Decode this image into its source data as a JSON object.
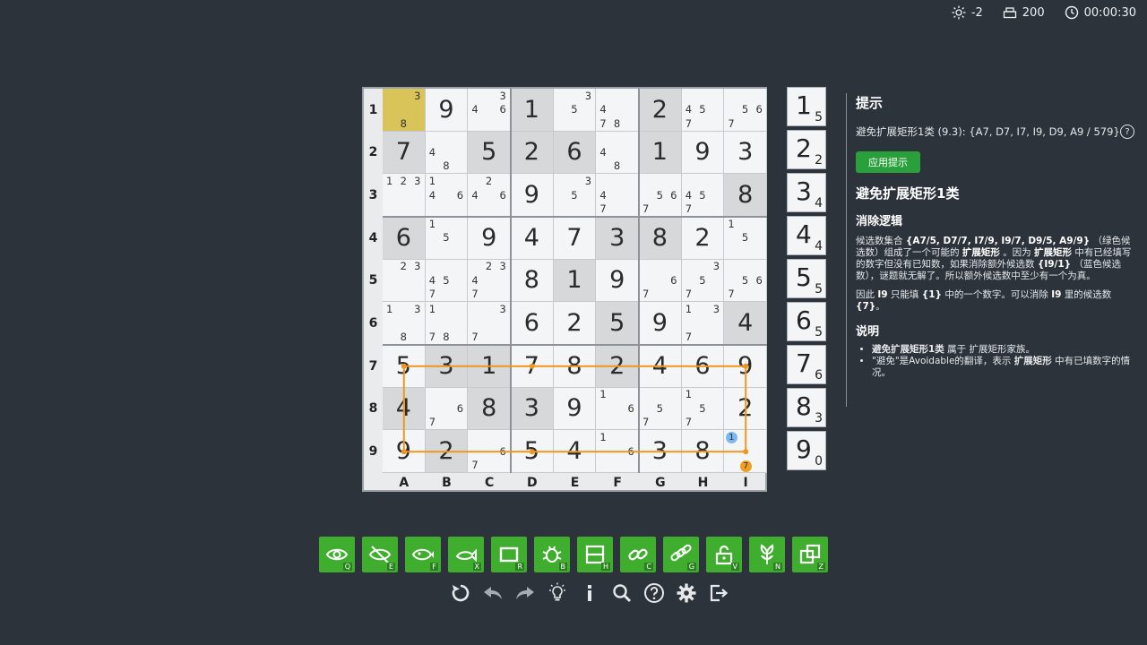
{
  "status": {
    "brightness": "-2",
    "score": "200",
    "timer": "00:00:30"
  },
  "rows": [
    "1",
    "2",
    "3",
    "4",
    "5",
    "6",
    "7",
    "8",
    "9"
  ],
  "cols": [
    "A",
    "B",
    "C",
    "D",
    "E",
    "F",
    "G",
    "H",
    "I"
  ],
  "cells": [
    [
      {
        "c": [
          "",
          "",
          "3",
          "",
          "",
          "",
          "",
          "8",
          ""
        ],
        "bg": "hl"
      },
      {
        "v": "9"
      },
      {
        "c": [
          "",
          "",
          "3",
          "4",
          "",
          "6",
          "",
          "",
          ""
        ]
      },
      {
        "v": "1",
        "bg": "g"
      },
      {
        "c": [
          "",
          "",
          "3",
          "",
          "5",
          "",
          "",
          "",
          ""
        ]
      },
      {
        "c": [
          "",
          "",
          "",
          "4",
          "",
          "",
          "7",
          "8",
          ""
        ]
      },
      {
        "v": "2",
        "bg": "g"
      },
      {
        "c": [
          "",
          "",
          "",
          "4",
          "5",
          "",
          "7",
          "",
          ""
        ]
      },
      {
        "c": [
          "",
          "",
          "",
          "",
          "5",
          "6",
          "7",
          "",
          ""
        ]
      }
    ],
    [
      {
        "v": "7",
        "bg": "g"
      },
      {
        "c": [
          "",
          "",
          "",
          "4",
          "",
          "",
          "",
          "8",
          ""
        ]
      },
      {
        "v": "5",
        "bg": "g"
      },
      {
        "v": "2",
        "bg": "g"
      },
      {
        "v": "6",
        "bg": "g"
      },
      {
        "c": [
          "",
          "",
          "",
          "4",
          "",
          "",
          "",
          "8",
          ""
        ]
      },
      {
        "v": "1",
        "bg": "g"
      },
      {
        "v": "9"
      },
      {
        "v": "3"
      }
    ],
    [
      {
        "c": [
          "1",
          "2",
          "3",
          "",
          "",
          "",
          "",
          "",
          ""
        ]
      },
      {
        "c": [
          "1",
          "",
          "",
          "4",
          "",
          "6",
          "",
          "",
          ""
        ]
      },
      {
        "c": [
          "",
          "2",
          "",
          "4",
          "",
          "6",
          "",
          "",
          ""
        ]
      },
      {
        "v": "9"
      },
      {
        "c": [
          "",
          "",
          "3",
          "",
          "5",
          "",
          "",
          "",
          ""
        ]
      },
      {
        "c": [
          "",
          "",
          "",
          "4",
          "",
          "",
          "7",
          "",
          ""
        ]
      },
      {
        "c": [
          "",
          "",
          "",
          "",
          "5",
          "6",
          "7",
          "",
          ""
        ]
      },
      {
        "c": [
          "",
          "",
          "",
          "4",
          "5",
          "",
          "7",
          "",
          ""
        ]
      },
      {
        "v": "8",
        "bg": "g"
      }
    ],
    [
      {
        "v": "6",
        "bg": "g"
      },
      {
        "c": [
          "1",
          "",
          "",
          "",
          "5",
          "",
          "",
          "",
          ""
        ]
      },
      {
        "v": "9"
      },
      {
        "v": "4"
      },
      {
        "v": "7"
      },
      {
        "v": "3",
        "bg": "g"
      },
      {
        "v": "8",
        "bg": "g"
      },
      {
        "v": "2"
      },
      {
        "c": [
          "1",
          "",
          "",
          "",
          "5",
          "",
          "",
          "",
          ""
        ]
      }
    ],
    [
      {
        "c": [
          "",
          "2",
          "3",
          "",
          "",
          "",
          "",
          "",
          ""
        ]
      },
      {
        "c": [
          "",
          "",
          "",
          "4",
          "5",
          "",
          "7",
          "",
          ""
        ]
      },
      {
        "c": [
          "",
          "2",
          "3",
          "4",
          "",
          "",
          "7",
          "",
          ""
        ]
      },
      {
        "v": "8"
      },
      {
        "v": "1",
        "bg": "g"
      },
      {
        "v": "9"
      },
      {
        "c": [
          "",
          "",
          "",
          "",
          "",
          "6",
          "7",
          "",
          ""
        ]
      },
      {
        "c": [
          "",
          "",
          "3",
          "",
          "5",
          "",
          "7",
          "",
          ""
        ]
      },
      {
        "c": [
          "",
          "",
          "",
          "",
          "5",
          "6",
          "7",
          "",
          ""
        ]
      }
    ],
    [
      {
        "c": [
          "1",
          "",
          "3",
          "",
          "",
          "",
          "",
          "8",
          ""
        ]
      },
      {
        "c": [
          "1",
          "",
          "",
          "",
          "",
          "",
          "7",
          "8",
          ""
        ]
      },
      {
        "c": [
          "",
          "",
          "3",
          "",
          "",
          "",
          "7",
          "",
          ""
        ]
      },
      {
        "v": "6"
      },
      {
        "v": "2"
      },
      {
        "v": "5",
        "bg": "g"
      },
      {
        "v": "9"
      },
      {
        "c": [
          "1",
          "",
          "3",
          "",
          "",
          "",
          "7",
          "",
          ""
        ]
      },
      {
        "v": "4",
        "bg": "g"
      }
    ],
    [
      {
        "v": "5"
      },
      {
        "v": "3",
        "bg": "g"
      },
      {
        "v": "1",
        "bg": "g"
      },
      {
        "v": "7"
      },
      {
        "v": "8"
      },
      {
        "v": "2",
        "bg": "g"
      },
      {
        "v": "4"
      },
      {
        "v": "6"
      },
      {
        "v": "9"
      }
    ],
    [
      {
        "v": "4",
        "bg": "g"
      },
      {
        "c": [
          "",
          "",
          "",
          "",
          "",
          "6",
          "7",
          "",
          ""
        ]
      },
      {
        "v": "8",
        "bg": "g"
      },
      {
        "v": "3",
        "bg": "g"
      },
      {
        "v": "9"
      },
      {
        "c": [
          "1",
          "",
          "",
          "",
          "",
          "6",
          "",
          "",
          ""
        ]
      },
      {
        "c": [
          "",
          "",
          "",
          "",
          "5",
          "",
          "7",
          "",
          ""
        ]
      },
      {
        "c": [
          "1",
          "",
          "",
          "",
          "5",
          "",
          "7",
          "",
          ""
        ]
      },
      {
        "v": "2"
      }
    ],
    [
      {
        "v": "9"
      },
      {
        "v": "2",
        "bg": "g"
      },
      {
        "c": [
          "",
          "",
          "",
          "",
          "",
          "6",
          "7",
          "",
          ""
        ]
      },
      {
        "v": "5"
      },
      {
        "v": "4"
      },
      {
        "c": [
          "1",
          "",
          "",
          "",
          "",
          "6",
          "",
          "",
          ""
        ]
      },
      {
        "v": "3"
      },
      {
        "v": "8"
      },
      {
        "c": [
          "1",
          "",
          "",
          "",
          "",
          "",
          "",
          "7",
          ""
        ],
        "mark": {
          "1": "blue",
          "7": "orange"
        }
      }
    ]
  ],
  "numpad": [
    {
      "n": "1",
      "c": "5"
    },
    {
      "n": "2",
      "c": "2"
    },
    {
      "n": "3",
      "c": "4"
    },
    {
      "n": "4",
      "c": "4"
    },
    {
      "n": "5",
      "c": "5"
    },
    {
      "n": "6",
      "c": "5"
    },
    {
      "n": "7",
      "c": "6"
    },
    {
      "n": "8",
      "c": "3"
    },
    {
      "n": "9",
      "c": "0"
    }
  ],
  "panel": {
    "title": "提示",
    "hint_line": "避免扩展矩形1类 (9.3): {A7, D7, I7, I9, D9, A9 / 579}",
    "apply_label": "应用提示",
    "technique": "避免扩展矩形1类",
    "section_logic": "消除逻辑",
    "logic_p1_a": "候选数集合",
    "logic_p1_b": "{A7/5, D7/7, I7/9, I9/7, D9/5, A9/9}",
    "logic_p1_c": "（绿色候选数）组成了一个可能的",
    "logic_p1_d": "扩展矩形",
    "logic_p1_e": "。因为",
    "logic_p1_f": "扩展矩形",
    "logic_p1_g": "中有已经填写的数字但没有已知数，如果消除额外候选数",
    "logic_p1_h": "{I9/1}",
    "logic_p1_i": "（蓝色候选数），谜题就无解了。所以额外候选数中至少有一个为真。",
    "logic_p2_a": "因此",
    "logic_p2_b": "I9",
    "logic_p2_c": "只能填",
    "logic_p2_d": "{1}",
    "logic_p2_e": "中的一个数字。可以消除",
    "logic_p2_f": "I9",
    "logic_p2_g": "里的候选数",
    "logic_p2_h": "{7}",
    "logic_p2_i": "。",
    "section_notes": "说明",
    "note1_a": "避免扩展矩形1类",
    "note1_b": "属于",
    "note1_link": "扩展矩形家族",
    "note1_c": "。",
    "note2_a": "\"避免\"是Avoidable的翻译，表示",
    "note2_b": "扩展矩形",
    "note2_c": "中有已填数字的情况。"
  },
  "toolbar": [
    {
      "icon": "eye-icon",
      "key": "Q"
    },
    {
      "icon": "eye-off-icon",
      "key": "E"
    },
    {
      "icon": "fish-eye-icon",
      "key": "F"
    },
    {
      "icon": "x-wing-icon",
      "key": "X"
    },
    {
      "icon": "rectangle-icon",
      "key": "R"
    },
    {
      "icon": "bug-icon",
      "key": "B"
    },
    {
      "icon": "hidden-rect-icon",
      "key": "H"
    },
    {
      "icon": "chain-icon",
      "key": "C"
    },
    {
      "icon": "group-chain-icon",
      "key": "G"
    },
    {
      "icon": "unlock-icon",
      "key": "V"
    },
    {
      "icon": "nishio-flower-icon",
      "key": "N"
    },
    {
      "icon": "copy-icon",
      "key": "Z"
    }
  ],
  "colors": {
    "highlight": "#d9c45a",
    "accent": "#3fae2e",
    "link": "#f0961e",
    "candidate_blue": "#7ab8f0",
    "candidate_orange": "#f0a020"
  }
}
